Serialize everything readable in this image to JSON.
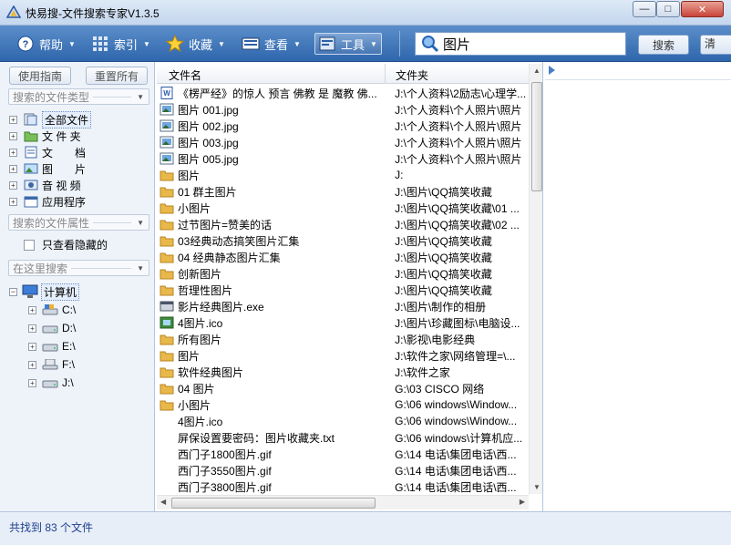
{
  "window": {
    "title": "快易搜-文件搜索专家V1.3.5",
    "min_label": "—",
    "max_label": "□",
    "close_label": "✕"
  },
  "toolbar": {
    "help": "帮助",
    "index": "索引",
    "favorites": "收藏",
    "view": "查看",
    "tools": "工具",
    "search_value": "图片",
    "search_button": "搜索",
    "clear_button": "清"
  },
  "sidebar": {
    "guide_button": "使用指南",
    "reset_button": "重置所有",
    "type_dropdown": "搜索的文件类型",
    "types": [
      {
        "label": "全部文件",
        "icon": "all-files-icon"
      },
      {
        "label": "文 件 夹",
        "icon": "folder-icon"
      },
      {
        "label": "文　　档",
        "icon": "document-icon"
      },
      {
        "label": "图　　片",
        "icon": "picture-icon"
      },
      {
        "label": "音 视 频",
        "icon": "media-icon"
      },
      {
        "label": "应用程序",
        "icon": "application-icon"
      }
    ],
    "attr_dropdown": "搜索的文件属性",
    "hidden_checkbox": "只查看隐藏的",
    "where_dropdown": "在这里搜索",
    "computer": "计算机",
    "drives": [
      "C:\\",
      "D:\\",
      "E:\\",
      "F:\\",
      "J:\\"
    ]
  },
  "list": {
    "columns": {
      "name": "文件名",
      "folder": "文件夹"
    },
    "rows": [
      {
        "name": "《楞严经》的惊人 预言 佛教 是 魔教 佛...",
        "folder": "J:\\个人资料\\2励志\\心理学...",
        "icon": "doc-icon"
      },
      {
        "name": "图片 001.jpg",
        "folder": "J:\\个人资料\\个人照片\\照片",
        "icon": "image-icon"
      },
      {
        "name": "图片 002.jpg",
        "folder": "J:\\个人资料\\个人照片\\照片",
        "icon": "image-icon"
      },
      {
        "name": "图片 003.jpg",
        "folder": "J:\\个人资料\\个人照片\\照片",
        "icon": "image-icon"
      },
      {
        "name": "图片 005.jpg",
        "folder": "J:\\个人资料\\个人照片\\照片",
        "icon": "image-icon"
      },
      {
        "name": "图片",
        "folder": "J:",
        "icon": "folder-icon"
      },
      {
        "name": "01 群主图片",
        "folder": "J:\\图片\\QQ搞笑收藏",
        "icon": "folder-icon"
      },
      {
        "name": "小图片",
        "folder": "J:\\图片\\QQ搞笑收藏\\01 ...",
        "icon": "folder-icon"
      },
      {
        "name": "过节图片=赞美的话",
        "folder": "J:\\图片\\QQ搞笑收藏\\02 ...",
        "icon": "folder-icon"
      },
      {
        "name": "03经典动态搞笑图片汇集",
        "folder": "J:\\图片\\QQ搞笑收藏",
        "icon": "folder-icon"
      },
      {
        "name": "04 经典静态图片汇集",
        "folder": "J:\\图片\\QQ搞笑收藏",
        "icon": "folder-icon"
      },
      {
        "name": "创新图片",
        "folder": "J:\\图片\\QQ搞笑收藏",
        "icon": "folder-icon"
      },
      {
        "name": "哲理性图片",
        "folder": "J:\\图片\\QQ搞笑收藏",
        "icon": "folder-icon"
      },
      {
        "name": "影片经典图片.exe",
        "folder": "J:\\图片\\制作的相册",
        "icon": "exe-icon"
      },
      {
        "name": "4图片.ico",
        "folder": "J:\\图片\\珍藏图标\\电脑设...",
        "icon": "ico-icon"
      },
      {
        "name": "所有图片",
        "folder": "J:\\影视\\电影经典",
        "icon": "folder-icon"
      },
      {
        "name": "图片",
        "folder": "J:\\软件之家\\网络管理=\\...",
        "icon": "folder-icon"
      },
      {
        "name": "软件经典图片",
        "folder": "J:\\软件之家",
        "icon": "folder-icon"
      },
      {
        "name": "04 图片",
        "folder": "G:\\03 CISCO 网络",
        "icon": "folder-icon"
      },
      {
        "name": "小图片",
        "folder": "G:\\06 windows\\Window...",
        "icon": "folder-icon"
      },
      {
        "name": "4图片.ico",
        "folder": "G:\\06 windows\\Window...",
        "icon": "blank-icon"
      },
      {
        "name": "屏保设置要密码：图片收藏夹.txt",
        "folder": "G:\\06 windows\\计算机应...",
        "icon": "blank-icon"
      },
      {
        "name": "西门子1800图片.gif",
        "folder": "G:\\14 电话\\集团电话\\西...",
        "icon": "blank-icon"
      },
      {
        "name": "西门子3550图片.gif",
        "folder": "G:\\14 电话\\集团电话\\西...",
        "icon": "blank-icon"
      },
      {
        "name": "西门子3800图片.gif",
        "folder": "G:\\14 电话\\集团电话\\西...",
        "icon": "blank-icon"
      }
    ]
  },
  "status": {
    "text": "共找到 83 个文件"
  },
  "colors": {
    "toolbar": "#3a72b8",
    "panel": "#eef3fa",
    "folder": "#e8b84a",
    "status_text": "#1a3f8f"
  }
}
